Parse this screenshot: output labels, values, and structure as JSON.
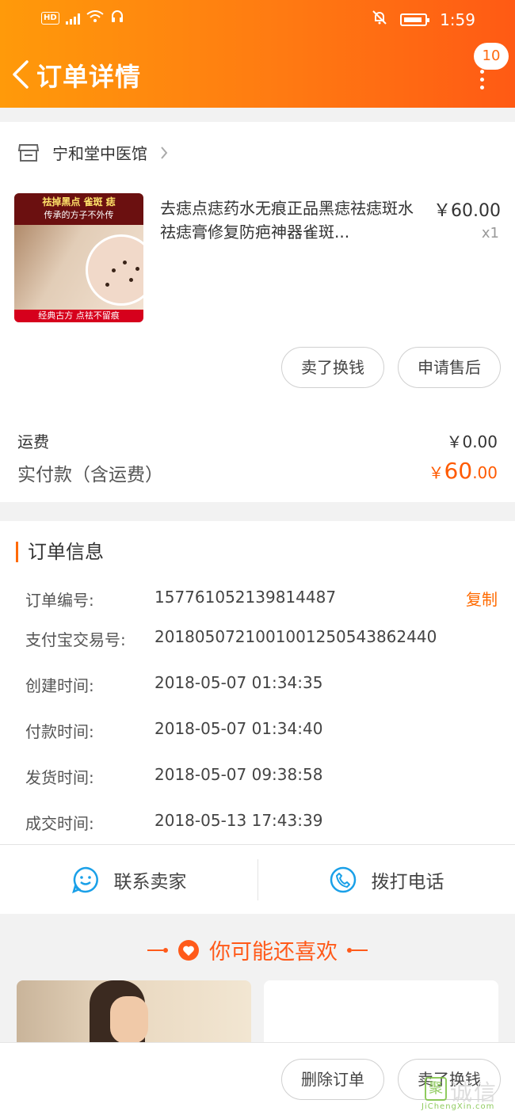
{
  "status_bar": {
    "left": "HD  4G",
    "time": "1:59"
  },
  "header": {
    "title": "订单详情",
    "message_count": "10"
  },
  "shop": {
    "name": "宁和堂中医馆"
  },
  "product": {
    "image_texts": {
      "banner": "祛掉黑点 雀斑 痣",
      "tagline": "传承的方子不外传",
      "footer": "经典古方 点祛不留痕"
    },
    "title": "去痣点痣药水无痕正品黑痣祛痣斑水祛痣膏修复防疤神器雀斑...",
    "price": "￥60.00",
    "quantity": "x1"
  },
  "item_actions": {
    "sell_label": "卖了换钱",
    "after_sale_label": "申请售后"
  },
  "totals": {
    "shipping_label": "运费",
    "shipping_value": "￥0.00",
    "paid_label": "实付款（含运费）",
    "paid_currency": "￥",
    "paid_integer": "60",
    "paid_decimal": ".00"
  },
  "order_info": {
    "section_title": "订单信息",
    "copy_label": "复制",
    "rows": [
      {
        "key": "订单编号:",
        "value": "157761052139814487"
      },
      {
        "key": "支付宝交易号:",
        "value": "2018050721001001250543862440"
      },
      {
        "key": "创建时间:",
        "value": "2018-05-07 01:34:35"
      },
      {
        "key": "付款时间:",
        "value": "2018-05-07 01:34:40"
      },
      {
        "key": "发货时间:",
        "value": "2018-05-07 09:38:58"
      },
      {
        "key": "成交时间:",
        "value": "2018-05-13 17:43:39"
      }
    ]
  },
  "contact": {
    "seller_label": "联系卖家",
    "call_label": "拨打电话"
  },
  "recommend": {
    "title": "你可能还喜欢"
  },
  "bottom_bar": {
    "delete_label": "删除订单",
    "sell_label": "卖了换钱"
  },
  "watermark": {
    "box": "聚",
    "text": "诚信",
    "url": "JiChengXin.com"
  },
  "colors": {
    "accent": "#ff6a00",
    "header_gradient_start": "#ff9a0a",
    "header_gradient_end": "#ff5a14"
  }
}
